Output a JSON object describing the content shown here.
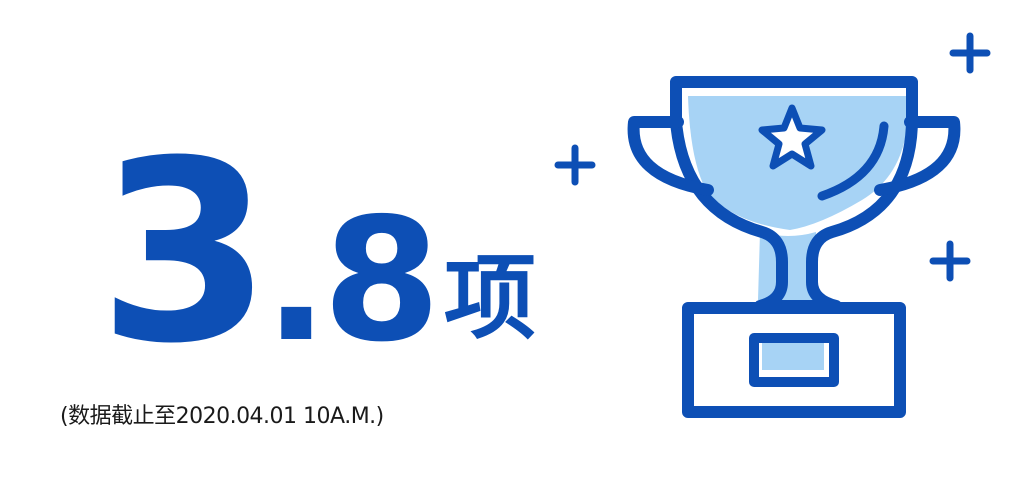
{
  "stat": {
    "integer": "3",
    "separator": ".",
    "decimal": "8",
    "unit": "项"
  },
  "footnote": "(数据截止至2020.04.01 10A.M.)",
  "colors": {
    "primary": "#0d4fb5",
    "light_fill": "#a7d3f5",
    "background": "#ffffff"
  },
  "icons": {
    "trophy": "trophy-icon",
    "star": "star-icon",
    "sparkles": "plus-sparkle-icon"
  }
}
